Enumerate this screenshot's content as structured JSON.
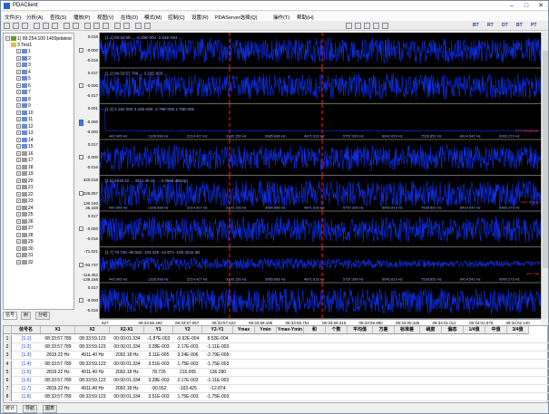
{
  "app": {
    "title": "PDAClient"
  },
  "menu": [
    "文件(F)",
    "分析(A)",
    "查找(S)",
    "播放(P)",
    "视图(V)",
    "在线(O)",
    "模式(M)",
    "控制(C)",
    "设置(R)",
    "PDAServer选择(Q)",
    "操作(T)",
    "帮助(H)"
  ],
  "toolbar": {
    "labels": [
      "BT",
      "RT",
      "DT",
      "BT",
      "PT"
    ]
  },
  "tree": {
    "root": "1) 89.254.100 1400pdatest",
    "child": "3 Test1",
    "items": [
      "1",
      "2",
      "3",
      "4",
      "5",
      "6",
      "7",
      "8",
      "9",
      "10",
      "11",
      "12",
      "13",
      "14",
      "15",
      "16",
      "17",
      "18",
      "19",
      "20",
      "21",
      "22",
      "23",
      "24",
      "25",
      "26",
      "27",
      "28",
      "29",
      "30",
      "31",
      "32"
    ]
  },
  "left_tabs": [
    "信号",
    "树",
    "分组"
  ],
  "bottom_tabs": [
    "统计",
    "导航",
    "图表"
  ],
  "panels": [
    {
      "type": "time",
      "y_top": "0.016",
      "y_mid": "-0.000",
      "y_bot": "-0.016",
      "cursor_text": "[1.1] 08:33:59 ...  -3.25E-004  -2.54E-004  ..."
    },
    {
      "type": "time",
      "y_top": "0.017",
      "y_mid": "-0.000",
      "y_bot": "-0.017",
      "cursor_text": "[1.2] 08:33:57 789 ... 3.22E-003 ..."
    },
    {
      "type": "fft",
      "y_top": "0.001",
      "y_mid": "-0.000",
      "y_bot": "-0.000",
      "cursor_text": "[1.3] 3.11E-005  3.24E-006  -2.79E-005  1.76E-005",
      "caption": "FFT Amplitude"
    },
    {
      "type": "time",
      "y_top": "0.017",
      "y_mid": "-0.000",
      "y_bot": "-0.016",
      "cursor_text": ""
    },
    {
      "type": "fft",
      "y_top": "320.018",
      "y_mid": "225.057",
      "y_bot": "130.150",
      "y_bot2": "35.328",
      "cursor_text": "[1.5] 2819.22 ... 4911.40 Hz ... 0.3958 dB/sqrt",
      "caption": "FFT Phase"
    },
    {
      "type": "time",
      "y_top": "0.017",
      "y_mid": "-0.000",
      "y_bot": "-0.016",
      "cursor_text": ""
    },
    {
      "type": "fft",
      "y_top": "-71.021",
      "y_mid": "-93.737",
      "y_bot": "-116.452",
      "y_bot2": "-139.168",
      "cursor_text": "[1.7] 78.726 -90.552 -103.425 -12.874 -106.4242 dB",
      "caption": "FFT dB"
    },
    {
      "type": "time",
      "y_top": "0.017",
      "y_mid": "-0.000",
      "y_bot": "-0.016",
      "cursor_text": ""
    }
  ],
  "freq_ticks": [
    "442.905 Hz",
    "1328.998 Hz",
    "2214.427 Hz",
    "3100.156 Hz",
    "3985.686 Hz",
    "4871.618 Hz",
    "5757.390 Hz",
    "6642.819 Hz",
    "7528.851 Hz",
    "8414.542 Hz",
    "9300.273 Hz"
  ],
  "time_ticks": [
    "827",
    "08:33:56.492",
    "08:33:57.057",
    "08:33:57.622",
    "08:33:58.186",
    "08:33:58.751",
    "08:33:59.316",
    "08:33:59.880",
    "08:34:00.445",
    "08:34:01.011",
    "08:34:01.575",
    "08:34:02.140"
  ],
  "table": {
    "headers": [
      "",
      "信号名",
      "X1",
      "X2",
      "X2-X1",
      "Y1",
      "Y2",
      "Y2-Y1",
      "Ymax",
      "Ymin",
      "Ymax-Ymin",
      "和",
      "个数",
      "平均值",
      "方差",
      "标准差",
      "峭度",
      "偏态",
      "1/4值",
      "中值",
      "3/4值"
    ],
    "rows": [
      [
        "1",
        "[1.1]",
        "08:33:57.789",
        "08:33:59.123",
        "00:00:01.334",
        "-1.87E-003",
        "-9.92E-004",
        "8.52E-004"
      ],
      [
        "2",
        "[1.2]",
        "08:33:57.789",
        "08:33:59.123",
        "00:00:01.334",
        "3.28E-003",
        "2.17E-003",
        "-1.11E-003"
      ],
      [
        "3",
        "[1.3]",
        "2819.22 Hz",
        "4911.40 Hz",
        "2092.18 Hz",
        "3.11E-005",
        "3.24E-006",
        "-2.79E-005"
      ],
      [
        "4",
        "[1.4]",
        "08:33:57.789",
        "08:33:59.123",
        "00:00:01.334",
        "3.51E-003",
        "1.75E-003",
        "-1.75E-003"
      ],
      [
        "5",
        "[1.5]",
        "2819.22 Hz",
        "4911.40 Hz",
        "2092.18 Hz",
        "78.726",
        "215.005",
        "136.280"
      ],
      [
        "6",
        "[1.6]",
        "08:33:57.789",
        "08:33:59.123",
        "00:00:01.334",
        "3.28E-003",
        "2.17E-003",
        "-1.11E-003"
      ],
      [
        "7",
        "[1.7]",
        "2819.22 Hz",
        "4911.40 Hz",
        "2092.18 Hz",
        "-90.552",
        "-103.425",
        "-12.874"
      ],
      [
        "8",
        "[1.8]",
        "08:33:57.789",
        "08:33:59.123",
        "00:00:01.334",
        "3.51E-003",
        "1.75E-003",
        "-1.75E-003"
      ]
    ]
  },
  "colors": {
    "trace": "#1030e8",
    "cursor": "#e81010",
    "plot_bg": "#000000",
    "label": "#c84040"
  },
  "chart_data": [
    {
      "type": "line",
      "title": "",
      "series": [
        {
          "name": "[1.1]",
          "style": "noise"
        }
      ],
      "ylim": [
        -0.016,
        0.016
      ]
    },
    {
      "type": "line",
      "title": "",
      "series": [
        {
          "name": "[1.2]",
          "style": "noise"
        }
      ],
      "ylim": [
        -0.017,
        0.017
      ]
    },
    {
      "type": "line",
      "title": "",
      "xlabel": "FFT Amplitude",
      "series": [
        {
          "name": "[1.3]",
          "style": "spike"
        }
      ],
      "ylim": [
        -0.0,
        0.001
      ]
    },
    {
      "type": "line",
      "title": "",
      "series": [
        {
          "name": "[1.4]",
          "style": "noise"
        }
      ],
      "ylim": [
        -0.016,
        0.017
      ]
    },
    {
      "type": "line",
      "title": "",
      "xlabel": "FFT Phase",
      "series": [
        {
          "name": "[1.5]",
          "style": "dense"
        }
      ],
      "ylim": [
        35.328,
        320.018
      ]
    },
    {
      "type": "line",
      "title": "",
      "series": [
        {
          "name": "[1.6]",
          "style": "noise"
        }
      ],
      "ylim": [
        -0.016,
        0.017
      ]
    },
    {
      "type": "line",
      "title": "",
      "xlabel": "FFT dB",
      "series": [
        {
          "name": "[1.7]",
          "style": "spectrum"
        }
      ],
      "ylim": [
        -139.168,
        -71.021
      ]
    },
    {
      "type": "line",
      "title": "",
      "series": [
        {
          "name": "[1.8]",
          "style": "noise"
        }
      ],
      "ylim": [
        -0.016,
        0.017
      ]
    }
  ]
}
